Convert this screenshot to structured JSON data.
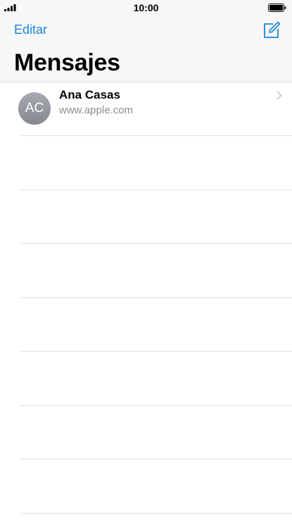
{
  "status_bar": {
    "time": "10:00",
    "signal_icon": "signal-bars-icon",
    "battery_icon": "battery-full-icon"
  },
  "nav": {
    "edit_label": "Editar",
    "compose_icon": "compose-icon",
    "title": "Mensajes"
  },
  "conversations": [
    {
      "initials": "AC",
      "name": "Ana Casas",
      "preview": "www.apple.com"
    }
  ],
  "colors": {
    "accent": "#1a86d9",
    "secondary_text": "#8e8e93",
    "separator": "#e3e3e3"
  }
}
